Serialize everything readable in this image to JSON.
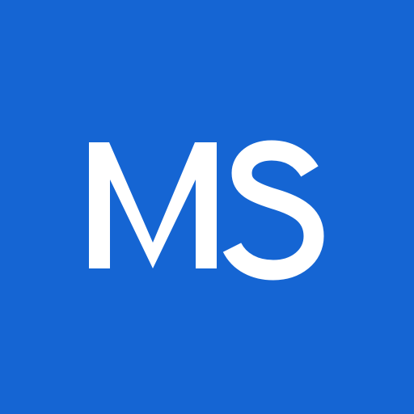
{
  "avatar": {
    "initials": "MS",
    "background_color": "#1565d3",
    "text_color": "#ffffff"
  }
}
